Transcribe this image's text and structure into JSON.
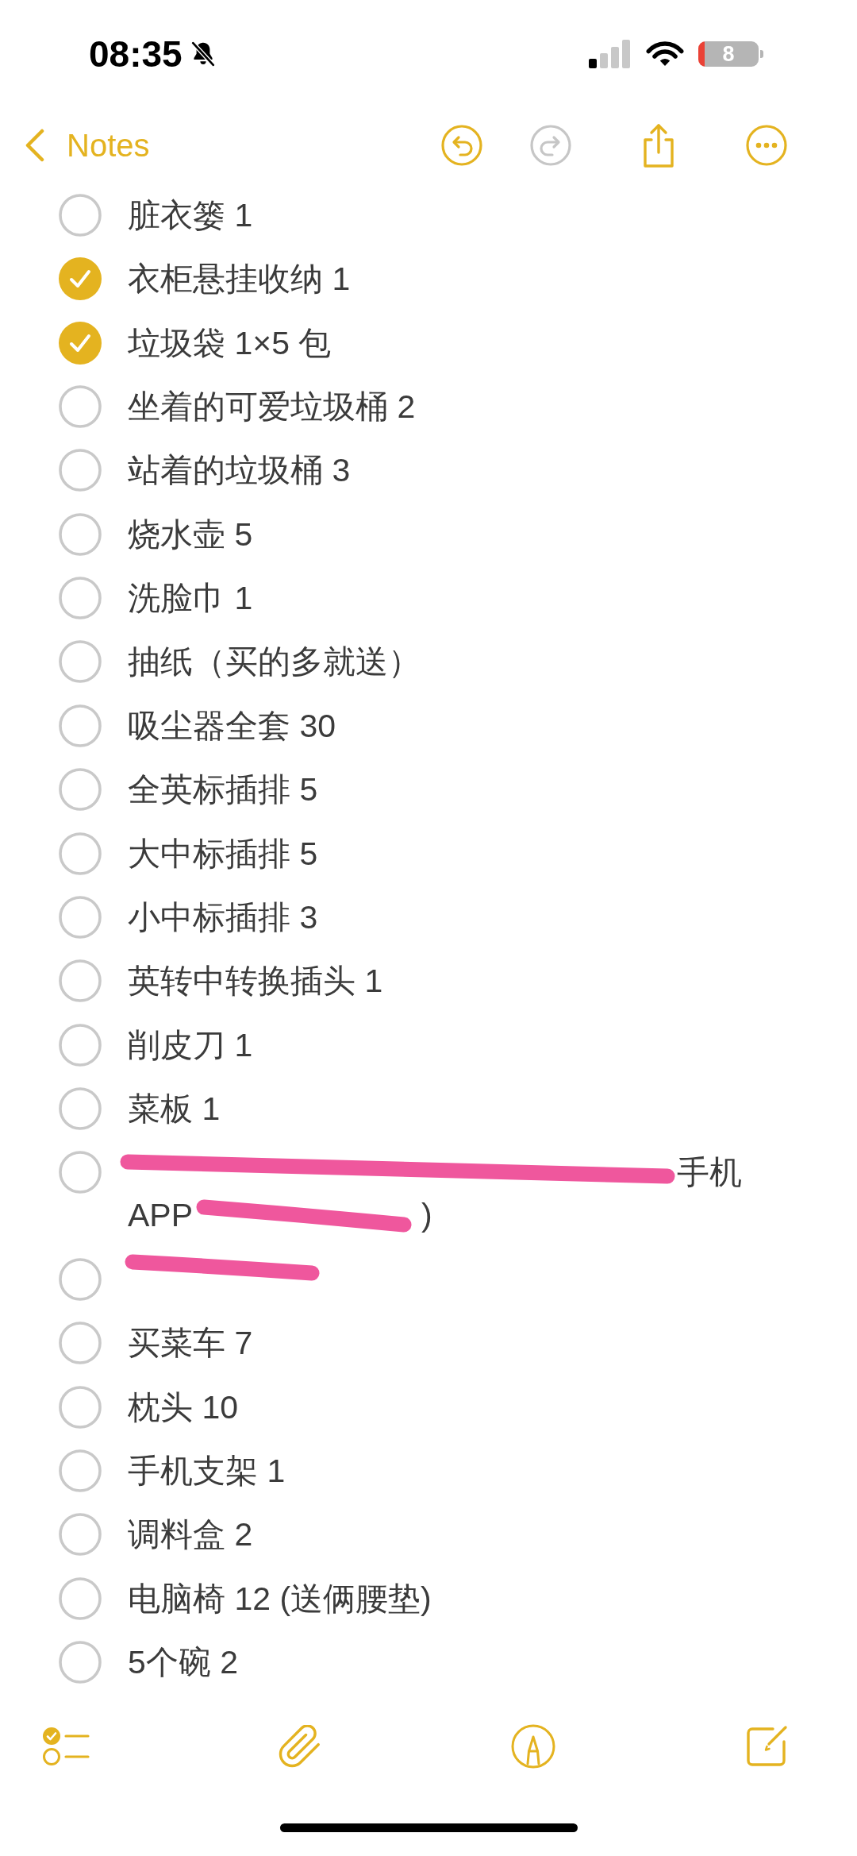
{
  "status_bar": {
    "time": "08:35",
    "silent": true,
    "battery": "8"
  },
  "nav": {
    "back_label": "Notes",
    "buttons": [
      {
        "kind": "undo",
        "disabled": false
      },
      {
        "kind": "redo",
        "disabled": true
      },
      {
        "kind": "share",
        "disabled": false
      },
      {
        "kind": "more",
        "disabled": false
      }
    ]
  },
  "checklist": [
    {
      "text": "脏衣篓 1",
      "checked": false,
      "scribbled": false
    },
    {
      "text": "衣柜悬挂收纳 1",
      "checked": true,
      "scribbled": false
    },
    {
      "text": "垃圾袋 1×5 包",
      "checked": true,
      "scribbled": false
    },
    {
      "text": "坐着的可爱垃圾桶 2",
      "checked": false,
      "scribbled": false
    },
    {
      "text": "站着的垃圾桶 3",
      "checked": false,
      "scribbled": false
    },
    {
      "text": "烧水壶 5",
      "checked": false,
      "scribbled": false
    },
    {
      "text": "洗脸巾 1",
      "checked": false,
      "scribbled": false
    },
    {
      "text": "抽纸（买的多就送）",
      "checked": false,
      "scribbled": false
    },
    {
      "text": "吸尘器全套 30",
      "checked": false,
      "scribbled": false
    },
    {
      "text": "全英标插排 5",
      "checked": false,
      "scribbled": false
    },
    {
      "text": "大中标插排 5",
      "checked": false,
      "scribbled": false
    },
    {
      "text": "小中标插排 3",
      "checked": false,
      "scribbled": false
    },
    {
      "text": "英转中转换插头 1",
      "checked": false,
      "scribbled": false
    },
    {
      "text": "削皮刀 1",
      "checked": false,
      "scribbled": false
    },
    {
      "text": "菜板 1",
      "checked": false,
      "scribbled": false
    },
    {
      "visible_parts": [
        "手机",
        "APP",
        ")"
      ],
      "checked": false,
      "scribbled": true
    },
    {
      "checked": false,
      "scribbled": true
    },
    {
      "text": "买菜车 7",
      "checked": false,
      "scribbled": false
    },
    {
      "text": "枕头 10",
      "checked": false,
      "scribbled": false
    },
    {
      "text": "手机支架 1",
      "checked": false,
      "scribbled": false
    },
    {
      "text": "调料盒 2",
      "checked": false,
      "scribbled": false
    },
    {
      "text": "电脑椅 12 (送俩腰垫)",
      "checked": false,
      "scribbled": false
    },
    {
      "text": "5个碗 2",
      "checked": false,
      "scribbled": false
    }
  ],
  "toolbar": [
    {
      "kind": "checklist"
    },
    {
      "kind": "attach"
    },
    {
      "kind": "markup"
    },
    {
      "kind": "compose"
    }
  ]
}
